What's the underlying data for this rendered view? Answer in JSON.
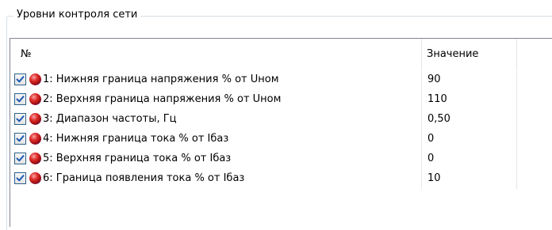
{
  "group": {
    "title": "Уровни контроля сети"
  },
  "table": {
    "columns": {
      "number": "№",
      "value": "Значение"
    },
    "rows": [
      {
        "name": "1: Нижняя граница напряжения % от Uном",
        "value": "90",
        "checked": true
      },
      {
        "name": "2: Верхняя граница напряжения % от Uном",
        "value": "110",
        "checked": true
      },
      {
        "name": "3: Диапазон частоты, Гц",
        "value": "0,50",
        "checked": true
      },
      {
        "name": "4: Нижняя граница тока % от Iбаз",
        "value": "0",
        "checked": true
      },
      {
        "name": "5: Верхняя граница тока % от Iбаз",
        "value": "0",
        "checked": true
      },
      {
        "name": "6: Граница появления тока % от Iбаз",
        "value": "10",
        "checked": true
      }
    ]
  },
  "icons": {
    "checkbox": "checkbox-checked-icon",
    "status": "red-ball-icon"
  },
  "colors": {
    "checkbox_border": "#2c628b",
    "checkmark": "#1e5bb5",
    "status_ball": "#d42424"
  }
}
